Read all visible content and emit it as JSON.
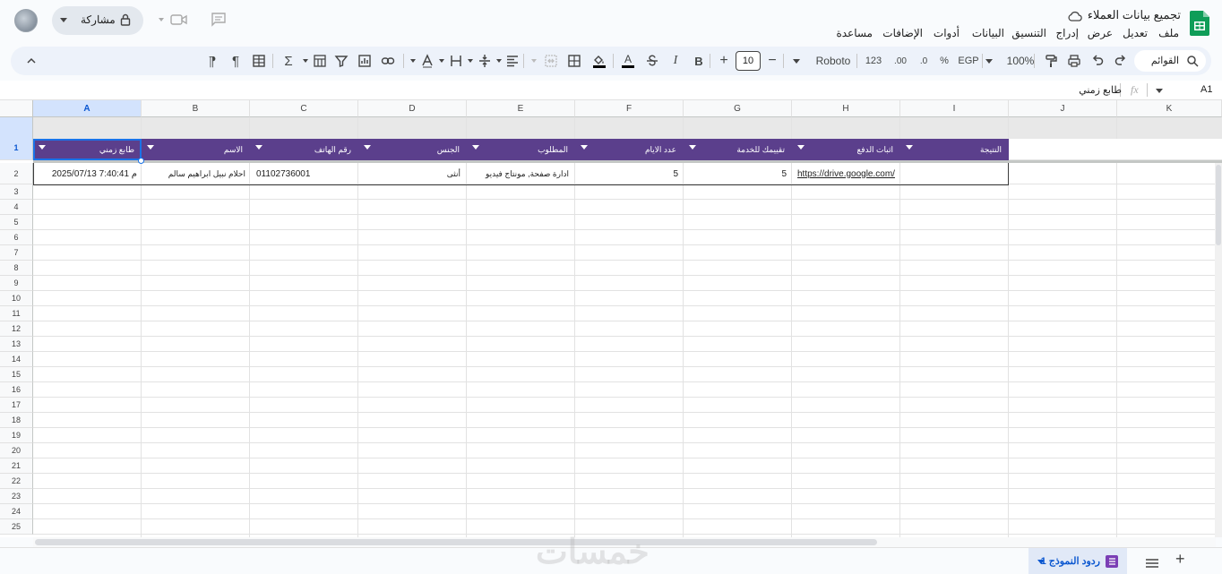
{
  "app": {
    "doc_title": "تجميع بيانات العملاء",
    "menus": [
      "ملف",
      "تعديل",
      "عرض",
      "إدراج",
      "التنسيق",
      "البيانات",
      "أدوات",
      "الإضافات",
      "مساعدة"
    ],
    "share_label": "مشاركة"
  },
  "toolbar": {
    "search_label": "القوائم",
    "zoom": "100%",
    "currency": "EGP",
    "percent": "%",
    "decrease_decimal": ".0",
    "increase_decimal": ".00",
    "number_format": "123",
    "font": "Roboto",
    "font_size": "10",
    "bold": "B",
    "italic": "I",
    "text_color": "A"
  },
  "formula_bar": {
    "cell_ref": "A1",
    "fx": "fx",
    "content": "طابع زمني"
  },
  "columns": [
    "A",
    "B",
    "C",
    "D",
    "E",
    "F",
    "G",
    "H",
    "I",
    "J",
    "K"
  ],
  "rows": [
    "1",
    "2",
    "3",
    "4",
    "5",
    "6",
    "7",
    "8",
    "9",
    "10",
    "11",
    "12",
    "13",
    "14",
    "15",
    "16",
    "17",
    "18",
    "19",
    "20",
    "21",
    "22",
    "23",
    "24",
    "25"
  ],
  "table": {
    "headers": [
      "طابع زمني",
      "الاسم",
      "رقم الهاتف",
      "الجنس",
      "المطلوب",
      "عدد الايام",
      "تقييمك للخدمة",
      "اثبات الدفع",
      "النتيجة"
    ],
    "row": [
      "2025/07/13 م 7:40:41",
      "احلام نبيل ابراهيم سالم",
      "01102736001",
      "أنثى",
      "ادارة صفحة, مونتاج فيديو",
      "5",
      "5",
      "https://drive.google.com/",
      ""
    ]
  },
  "sheet_tab": {
    "label": "ردود النموذج 1"
  },
  "watermark": "خمسات",
  "colors": {
    "header_bg": "#5b3f8c",
    "accent": "#1a73e8",
    "sheets_green": "#0f9d58"
  }
}
